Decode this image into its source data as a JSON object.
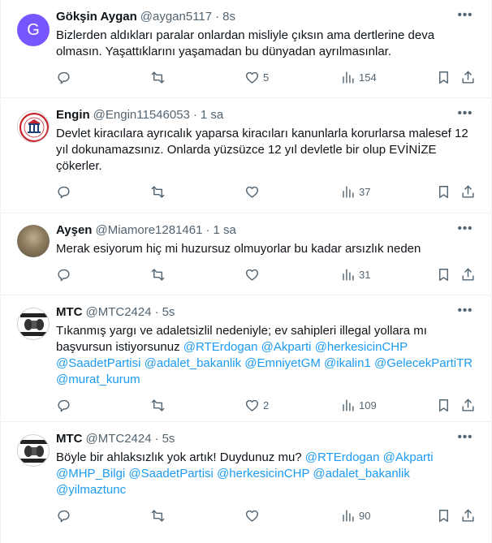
{
  "tweets": [
    {
      "name": "Gökşin Aygan",
      "handle": "@aygan5117",
      "time": "8s",
      "avatar_letter": "G",
      "text_lines": [
        "Bizlerden aldıkları paralar onlardan misliyle çıksın ama dertlerine deva",
        "olmasın. Yaşattıklarını yaşamadan bu dünyadan ayrılmasınlar."
      ],
      "reply_count": "",
      "retweet_count": "",
      "like_count": "5",
      "view_count": "154"
    },
    {
      "name": "Engin",
      "handle": "@Engin11546053",
      "time": "1 sa",
      "text_lines": [
        "Devlet kiracılara ayrıcalık yaparsa kiracıları kanunlarla korurlarsa malesef 12",
        "yıl dokunamazsınız. Onlarda yüzsüzce 12 yıl devletle bir olup EVİNİZE",
        "çökerler."
      ],
      "reply_count": "",
      "retweet_count": "",
      "like_count": "",
      "view_count": "37"
    },
    {
      "name": "Ayşen",
      "handle": "@Miamore1281461",
      "time": "1 sa",
      "text_lines": [
        "Merak esiyorum hiç mi huzursuz olmuyorlar bu kadar arsızlık neden"
      ],
      "reply_count": "",
      "retweet_count": "",
      "like_count": "",
      "view_count": "31"
    },
    {
      "name": "MTC",
      "handle": "@MTC2424",
      "time": "5s",
      "text_prefix": "Tıkanmış yargı ve adaletsizlil nedeniyle; ev sahipleri illegal yollara mı",
      "text_prefix2": "başvursun istiyorsunuz ",
      "mentions": [
        "@RTErdogan",
        "@Akparti",
        "@herkesicinCHP",
        "@SaadetPartisi",
        "@adalet_bakanlik",
        "@EmniyetGM",
        "@ikalin1",
        "@GelecekPartiTR",
        "@murat_kurum"
      ],
      "reply_count": "",
      "retweet_count": "",
      "like_count": "2",
      "view_count": "109"
    },
    {
      "name": "MTC",
      "handle": "@MTC2424",
      "time": "5s",
      "text_prefix": "Böyle bir ahlaksızlık yok artık! Duydunuz mu? ",
      "mentions": [
        "@RTErdogan",
        "@Akparti",
        "@MHP_Bilgi",
        "@SaadetPartisi",
        "@herkesicinCHP",
        "@adalet_bakanlik",
        "@yilmaztunc"
      ],
      "reply_count": "",
      "retweet_count": "",
      "like_count": "",
      "view_count": "90"
    }
  ],
  "dot_separator": "·",
  "more_glyph": "•••",
  "colors": {
    "accent": "#1d9bf0",
    "muted": "#536471",
    "text": "#0f1419",
    "border": "#eff3f4"
  }
}
